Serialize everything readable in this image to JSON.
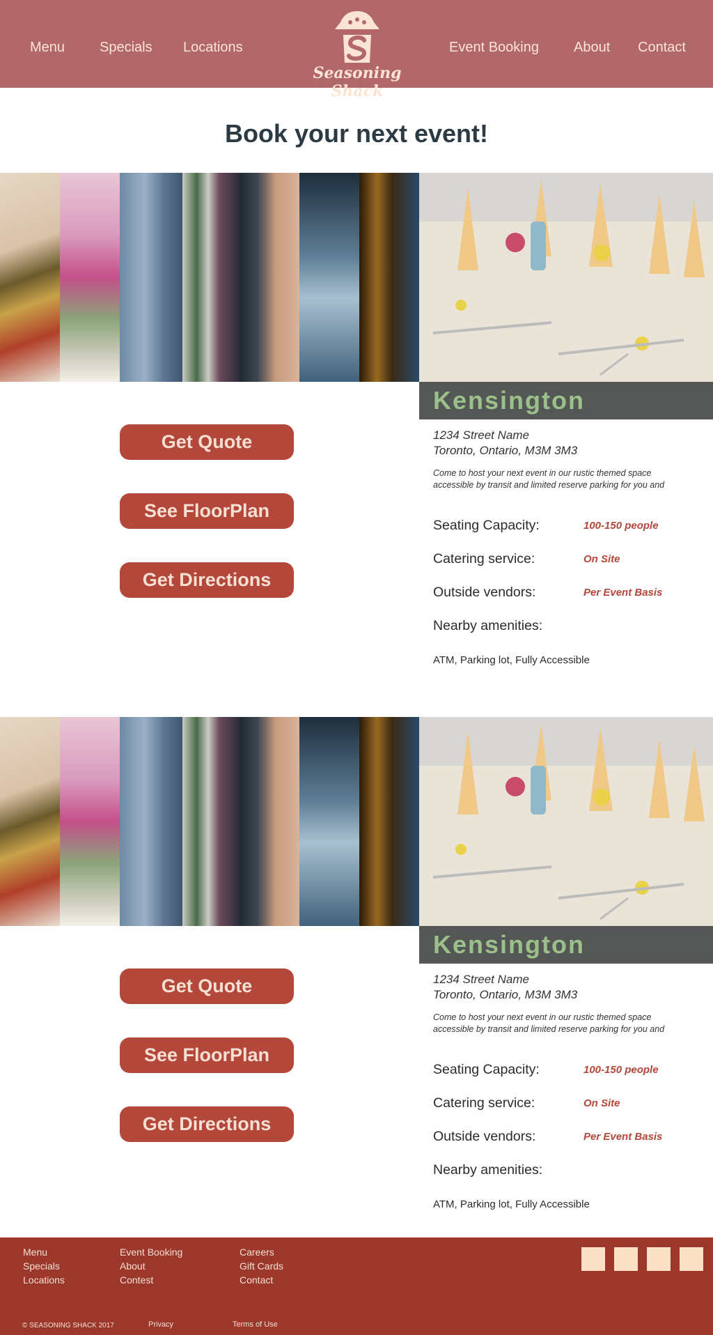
{
  "header": {
    "nav_left": [
      "Menu",
      "Specials",
      "Locations"
    ],
    "nav_right": [
      "Event Booking",
      "About",
      "Contact"
    ],
    "logo_text": "Seasoning Shack"
  },
  "page_title": "Book your next event!",
  "sections": [
    {
      "venue_name": "Kensington",
      "buttons": [
        "Get Quote",
        "See FloorPlan",
        "Get Directions"
      ],
      "address_line1": "1234 Street Name",
      "address_line2": "Toronto, Ontario, M3M 3M3",
      "description_line1": "Come to host your next event in our rustic themed space",
      "description_line2": "accessible by transit and limited reserve parking for you and",
      "details": [
        {
          "label": "Seating Capacity:",
          "value": "100-150 people"
        },
        {
          "label": "Catering service:",
          "value": "On Site"
        },
        {
          "label": "Outside vendors:",
          "value": "Per Event Basis"
        },
        {
          "label": "Nearby amenities:",
          "value": ""
        }
      ],
      "amenities": "ATM, Parking lot, Fully Accessible"
    },
    {
      "venue_name": "Kensington",
      "buttons": [
        "Get Quote",
        "See FloorPlan",
        "Get Directions"
      ],
      "address_line1": "1234 Street Name",
      "address_line2": "Toronto, Ontario, M3M 3M3",
      "description_line1": "Come to host your next event in our rustic themed space",
      "description_line2": "accessible by transit and limited reserve parking for you and",
      "details": [
        {
          "label": "Seating Capacity:",
          "value": "100-150 people"
        },
        {
          "label": "Catering service:",
          "value": "On Site"
        },
        {
          "label": "Outside vendors:",
          "value": "Per Event Basis"
        },
        {
          "label": "Nearby amenities:",
          "value": ""
        }
      ],
      "amenities": "ATM, Parking lot, Fully Accessible"
    }
  ],
  "footer": {
    "col1": [
      "Menu",
      "Specials",
      "Locations"
    ],
    "col2": [
      "Event Booking",
      "About",
      "Contest"
    ],
    "col3": [
      "Careers",
      "Gift Cards",
      "Contact"
    ],
    "copyright": "© SEASONING SHACK 2017",
    "privacy": "Privacy",
    "terms": "Terms of Use"
  },
  "colors": {
    "header_bg": "#b2676b",
    "accent": "#b3473a",
    "footer_bg": "#9b382b",
    "venue_bar": "#545756",
    "venue_name": "#9bc08a"
  }
}
